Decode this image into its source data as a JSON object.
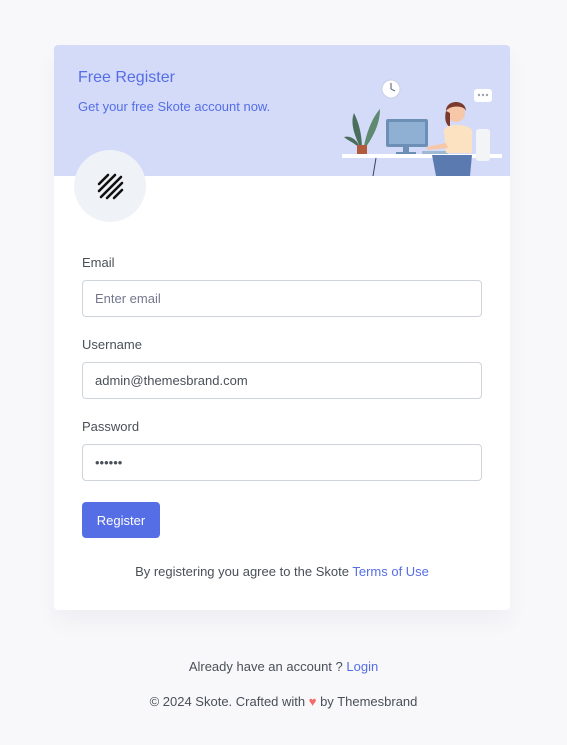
{
  "header": {
    "title": "Free Register",
    "subtitle": "Get your free Skote account now."
  },
  "form": {
    "email": {
      "label": "Email",
      "placeholder": "Enter email",
      "value": ""
    },
    "username": {
      "label": "Username",
      "value": "admin@themesbrand.com"
    },
    "password": {
      "label": "Password",
      "value": "••••••"
    },
    "submit_label": "Register"
  },
  "terms": {
    "text": "By registering you agree to the Skote ",
    "link": "Terms of Use"
  },
  "footer": {
    "login_prompt": "Already have an account ? ",
    "login_link": "Login",
    "copyright_prefix": "© 2024 Skote. Crafted with ",
    "heart": "♥",
    "copyright_suffix": " by Themesbrand"
  },
  "colors": {
    "primary": "#556ee6",
    "header_bg": "#d4dbf9",
    "page_bg": "#f8f8fb",
    "heart": "#f46a6a"
  }
}
